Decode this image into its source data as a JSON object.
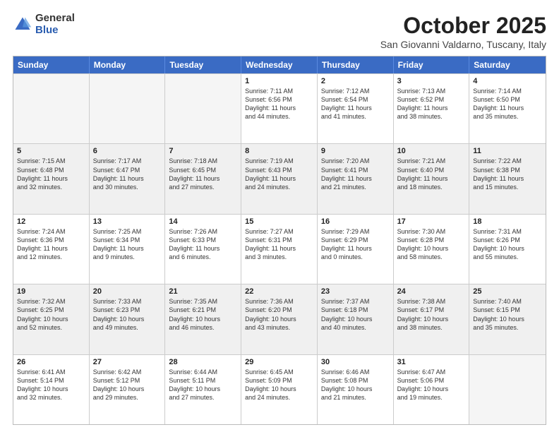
{
  "header": {
    "logo_general": "General",
    "logo_blue": "Blue",
    "month_title": "October 2025",
    "subtitle": "San Giovanni Valdarno, Tuscany, Italy"
  },
  "calendar": {
    "days": [
      "Sunday",
      "Monday",
      "Tuesday",
      "Wednesday",
      "Thursday",
      "Friday",
      "Saturday"
    ],
    "rows": [
      [
        {
          "num": "",
          "lines": [],
          "empty": true
        },
        {
          "num": "",
          "lines": [],
          "empty": true
        },
        {
          "num": "",
          "lines": [],
          "empty": true
        },
        {
          "num": "1",
          "lines": [
            "Sunrise: 7:11 AM",
            "Sunset: 6:56 PM",
            "Daylight: 11 hours",
            "and 44 minutes."
          ]
        },
        {
          "num": "2",
          "lines": [
            "Sunrise: 7:12 AM",
            "Sunset: 6:54 PM",
            "Daylight: 11 hours",
            "and 41 minutes."
          ]
        },
        {
          "num": "3",
          "lines": [
            "Sunrise: 7:13 AM",
            "Sunset: 6:52 PM",
            "Daylight: 11 hours",
            "and 38 minutes."
          ]
        },
        {
          "num": "4",
          "lines": [
            "Sunrise: 7:14 AM",
            "Sunset: 6:50 PM",
            "Daylight: 11 hours",
            "and 35 minutes."
          ]
        }
      ],
      [
        {
          "num": "5",
          "lines": [
            "Sunrise: 7:15 AM",
            "Sunset: 6:48 PM",
            "Daylight: 11 hours",
            "and 32 minutes."
          ],
          "shaded": true
        },
        {
          "num": "6",
          "lines": [
            "Sunrise: 7:17 AM",
            "Sunset: 6:47 PM",
            "Daylight: 11 hours",
            "and 30 minutes."
          ],
          "shaded": true
        },
        {
          "num": "7",
          "lines": [
            "Sunrise: 7:18 AM",
            "Sunset: 6:45 PM",
            "Daylight: 11 hours",
            "and 27 minutes."
          ],
          "shaded": true
        },
        {
          "num": "8",
          "lines": [
            "Sunrise: 7:19 AM",
            "Sunset: 6:43 PM",
            "Daylight: 11 hours",
            "and 24 minutes."
          ],
          "shaded": true
        },
        {
          "num": "9",
          "lines": [
            "Sunrise: 7:20 AM",
            "Sunset: 6:41 PM",
            "Daylight: 11 hours",
            "and 21 minutes."
          ],
          "shaded": true
        },
        {
          "num": "10",
          "lines": [
            "Sunrise: 7:21 AM",
            "Sunset: 6:40 PM",
            "Daylight: 11 hours",
            "and 18 minutes."
          ],
          "shaded": true
        },
        {
          "num": "11",
          "lines": [
            "Sunrise: 7:22 AM",
            "Sunset: 6:38 PM",
            "Daylight: 11 hours",
            "and 15 minutes."
          ],
          "shaded": true
        }
      ],
      [
        {
          "num": "12",
          "lines": [
            "Sunrise: 7:24 AM",
            "Sunset: 6:36 PM",
            "Daylight: 11 hours",
            "and 12 minutes."
          ]
        },
        {
          "num": "13",
          "lines": [
            "Sunrise: 7:25 AM",
            "Sunset: 6:34 PM",
            "Daylight: 11 hours",
            "and 9 minutes."
          ]
        },
        {
          "num": "14",
          "lines": [
            "Sunrise: 7:26 AM",
            "Sunset: 6:33 PM",
            "Daylight: 11 hours",
            "and 6 minutes."
          ]
        },
        {
          "num": "15",
          "lines": [
            "Sunrise: 7:27 AM",
            "Sunset: 6:31 PM",
            "Daylight: 11 hours",
            "and 3 minutes."
          ]
        },
        {
          "num": "16",
          "lines": [
            "Sunrise: 7:29 AM",
            "Sunset: 6:29 PM",
            "Daylight: 11 hours",
            "and 0 minutes."
          ]
        },
        {
          "num": "17",
          "lines": [
            "Sunrise: 7:30 AM",
            "Sunset: 6:28 PM",
            "Daylight: 10 hours",
            "and 58 minutes."
          ]
        },
        {
          "num": "18",
          "lines": [
            "Sunrise: 7:31 AM",
            "Sunset: 6:26 PM",
            "Daylight: 10 hours",
            "and 55 minutes."
          ]
        }
      ],
      [
        {
          "num": "19",
          "lines": [
            "Sunrise: 7:32 AM",
            "Sunset: 6:25 PM",
            "Daylight: 10 hours",
            "and 52 minutes."
          ],
          "shaded": true
        },
        {
          "num": "20",
          "lines": [
            "Sunrise: 7:33 AM",
            "Sunset: 6:23 PM",
            "Daylight: 10 hours",
            "and 49 minutes."
          ],
          "shaded": true
        },
        {
          "num": "21",
          "lines": [
            "Sunrise: 7:35 AM",
            "Sunset: 6:21 PM",
            "Daylight: 10 hours",
            "and 46 minutes."
          ],
          "shaded": true
        },
        {
          "num": "22",
          "lines": [
            "Sunrise: 7:36 AM",
            "Sunset: 6:20 PM",
            "Daylight: 10 hours",
            "and 43 minutes."
          ],
          "shaded": true
        },
        {
          "num": "23",
          "lines": [
            "Sunrise: 7:37 AM",
            "Sunset: 6:18 PM",
            "Daylight: 10 hours",
            "and 40 minutes."
          ],
          "shaded": true
        },
        {
          "num": "24",
          "lines": [
            "Sunrise: 7:38 AM",
            "Sunset: 6:17 PM",
            "Daylight: 10 hours",
            "and 38 minutes."
          ],
          "shaded": true
        },
        {
          "num": "25",
          "lines": [
            "Sunrise: 7:40 AM",
            "Sunset: 6:15 PM",
            "Daylight: 10 hours",
            "and 35 minutes."
          ],
          "shaded": true
        }
      ],
      [
        {
          "num": "26",
          "lines": [
            "Sunrise: 6:41 AM",
            "Sunset: 5:14 PM",
            "Daylight: 10 hours",
            "and 32 minutes."
          ]
        },
        {
          "num": "27",
          "lines": [
            "Sunrise: 6:42 AM",
            "Sunset: 5:12 PM",
            "Daylight: 10 hours",
            "and 29 minutes."
          ]
        },
        {
          "num": "28",
          "lines": [
            "Sunrise: 6:44 AM",
            "Sunset: 5:11 PM",
            "Daylight: 10 hours",
            "and 27 minutes."
          ]
        },
        {
          "num": "29",
          "lines": [
            "Sunrise: 6:45 AM",
            "Sunset: 5:09 PM",
            "Daylight: 10 hours",
            "and 24 minutes."
          ]
        },
        {
          "num": "30",
          "lines": [
            "Sunrise: 6:46 AM",
            "Sunset: 5:08 PM",
            "Daylight: 10 hours",
            "and 21 minutes."
          ]
        },
        {
          "num": "31",
          "lines": [
            "Sunrise: 6:47 AM",
            "Sunset: 5:06 PM",
            "Daylight: 10 hours",
            "and 19 minutes."
          ]
        },
        {
          "num": "",
          "lines": [],
          "empty": true
        }
      ]
    ]
  }
}
